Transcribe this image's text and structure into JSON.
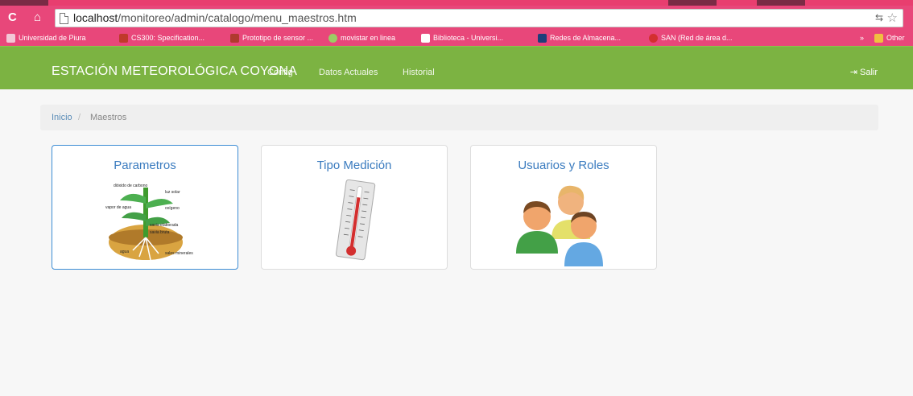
{
  "browser": {
    "url_host": "localhost",
    "url_path": "/monitoreo/admin/catalogo/menu_maestros.htm",
    "bookmarks": [
      {
        "label": "Universidad de Piura",
        "color": "#f2c7d6"
      },
      {
        "label": "CS300: Specification...",
        "color": "#c0392b"
      },
      {
        "label": "Prototipo de sensor ...",
        "color": "#b03a2e"
      },
      {
        "label": "movistar en linea",
        "color": "#9ccc65"
      },
      {
        "label": "Biblioteca - Universi...",
        "color": "#ffffff"
      },
      {
        "label": "Redes de Almacena...",
        "color": "#1e3f7a"
      },
      {
        "label": "SAN (Red de área d...",
        "color": "#d32f2f"
      }
    ],
    "other_bookmarks": "Other"
  },
  "navbar": {
    "brand": "ESTACIÓN METEOROLÓGICA COYONA",
    "links": [
      "Config",
      "Datos Actuales",
      "Historial"
    ],
    "logout": "Salir",
    "color": "#7cb342"
  },
  "breadcrumb": {
    "home": "Inicio",
    "separator": "/",
    "current": "Maestros"
  },
  "tiles": [
    {
      "title": "Parametros",
      "icon": "plant-diagram-icon",
      "labels": [
        "dióxido de carbono",
        "luz solar",
        "vapor de agua",
        "oxígeno",
        "savia elaborada",
        "savia bruta",
        "agua",
        "sales minerales"
      ]
    },
    {
      "title": "Tipo Medición",
      "icon": "thermometer-icon"
    },
    {
      "title": "Usuarios y Roles",
      "icon": "users-group-icon"
    }
  ]
}
